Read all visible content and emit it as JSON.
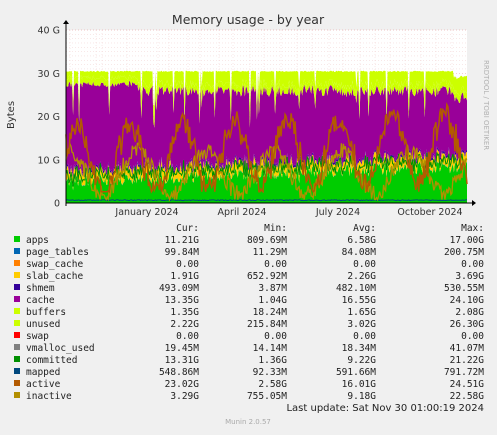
{
  "chart_data": {
    "type": "area",
    "title": "Memory usage - by year",
    "ylabel": "Bytes",
    "watermark": "RRDTOOL / TOBI OETIKER",
    "ylim": [
      0,
      40
    ],
    "y_unit": "G",
    "y_ticks": [
      "0",
      "10 G",
      "20 G",
      "30 G",
      "40 G"
    ],
    "x_ticks": [
      "January 2024",
      "April 2024",
      "July 2024",
      "October 2024"
    ],
    "grid": true,
    "legend_headers": [
      "Cur:",
      "Min:",
      "Avg:",
      "Max:"
    ],
    "stacked_series": [
      "apps",
      "page_tables",
      "swap_cache",
      "slab_cache",
      "shmem",
      "cache",
      "buffers",
      "unused",
      "swap"
    ],
    "line_series": [
      "vmalloc_used",
      "committed",
      "mapped",
      "active",
      "inactive"
    ],
    "approx_values_G": {
      "apps_typical": 6.58,
      "slab_cache_typical": 2.26,
      "cache_typical": 16.55,
      "buffers_typical": 1.65,
      "unused_typical": 3.02,
      "active_typical": 16.01,
      "inactive_typical": 9.18,
      "committed_typical": 9.22
    },
    "series": [
      {
        "name": "apps",
        "color": "#00cc00",
        "cur": "11.21G",
        "min": "809.69M",
        "avg": "6.58G",
        "max": "17.00G"
      },
      {
        "name": "page_tables",
        "color": "#0066b3",
        "cur": "99.84M",
        "min": "11.29M",
        "avg": "84.08M",
        "max": "200.75M"
      },
      {
        "name": "swap_cache",
        "color": "#ff8000",
        "cur": "0.00",
        "min": "0.00",
        "avg": "0.00",
        "max": "0.00"
      },
      {
        "name": "slab_cache",
        "color": "#ffcc00",
        "cur": "1.91G",
        "min": "652.92M",
        "avg": "2.26G",
        "max": "3.69G"
      },
      {
        "name": "shmem",
        "color": "#330099",
        "cur": "493.09M",
        "min": "3.87M",
        "avg": "482.10M",
        "max": "530.55M"
      },
      {
        "name": "cache",
        "color": "#990099",
        "cur": "13.35G",
        "min": "1.04G",
        "avg": "16.55G",
        "max": "24.10G"
      },
      {
        "name": "buffers",
        "color": "#ccff00",
        "cur": "1.35G",
        "min": "18.24M",
        "avg": "1.65G",
        "max": "2.08G"
      },
      {
        "name": "unused",
        "color": "#ccff00",
        "cur": "2.22G",
        "min": "215.84M",
        "avg": "3.02G",
        "max": "26.30G"
      },
      {
        "name": "swap",
        "color": "#ff0000",
        "cur": "0.00",
        "min": "0.00",
        "avg": "0.00",
        "max": "0.00"
      },
      {
        "name": "vmalloc_used",
        "color": "#808080",
        "cur": "19.45M",
        "min": "14.14M",
        "avg": "18.34M",
        "max": "41.07M"
      },
      {
        "name": "committed",
        "color": "#008f00",
        "cur": "13.31G",
        "min": "1.36G",
        "avg": "9.22G",
        "max": "21.22G"
      },
      {
        "name": "mapped",
        "color": "#00487d",
        "cur": "548.86M",
        "min": "92.33M",
        "avg": "591.66M",
        "max": "791.72M"
      },
      {
        "name": "active",
        "color": "#b35a00",
        "cur": "23.02G",
        "min": "2.58G",
        "avg": "16.01G",
        "max": "24.51G"
      },
      {
        "name": "inactive",
        "color": "#b38f00",
        "cur": "3.29G",
        "min": "755.05M",
        "avg": "9.18G",
        "max": "22.58G"
      }
    ]
  },
  "footer": {
    "last_update": "Last update: Sat Nov 30 01:00:19 2024",
    "version": "Munin 2.0.57"
  }
}
